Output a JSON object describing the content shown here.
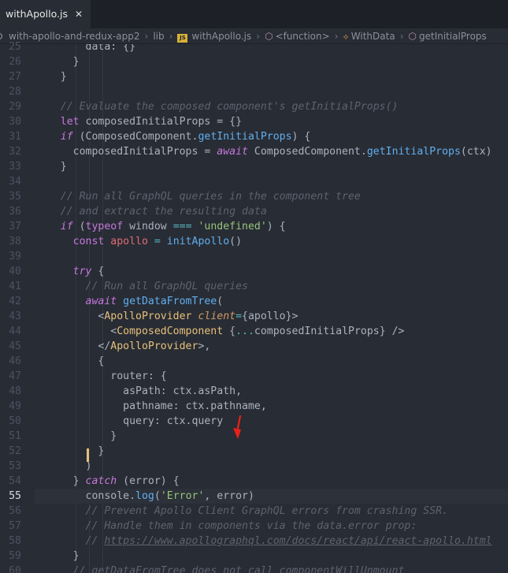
{
  "tab": {
    "title": "withApollo.js",
    "close": "✕"
  },
  "breadcrumb": [
    {
      "label": "with-apollo-and-redux-app2",
      "icon": "disk-icon"
    },
    {
      "label": "lib",
      "icon": ""
    },
    {
      "label": "withApollo.js",
      "icon": "js-file-icon"
    },
    {
      "label": "<function>",
      "icon": "cube-icon"
    },
    {
      "label": "WithData",
      "icon": "component-icon"
    },
    {
      "label": "getInitialProps",
      "icon": "cube-icon"
    }
  ],
  "editor": {
    "current_line": 55,
    "line_numbers": [
      25,
      26,
      27,
      28,
      29,
      30,
      31,
      32,
      33,
      34,
      35,
      36,
      37,
      38,
      39,
      40,
      41,
      42,
      43,
      44,
      45,
      46,
      47,
      48,
      49,
      50,
      51,
      52,
      53,
      54,
      55,
      56,
      57,
      58,
      59,
      60
    ],
    "lines": [
      [
        [
          "p",
          "        data: {}"
        ]
      ],
      [
        [
          "p",
          "      }"
        ]
      ],
      [
        [
          "p",
          "    }"
        ]
      ],
      [
        [
          "p",
          ""
        ]
      ],
      [
        [
          "c",
          "    // Evaluate the composed component's getInitialProps()"
        ]
      ],
      [
        [
          "k",
          "    let "
        ],
        [
          "p",
          "composedInitialProps = {}"
        ]
      ],
      [
        [
          "ki",
          "    if "
        ],
        [
          "p",
          "(ComposedComponent."
        ],
        [
          "f",
          "getInitialProps"
        ],
        [
          "p",
          ") {"
        ]
      ],
      [
        [
          "p",
          "      composedInitialProps = "
        ],
        [
          "ki",
          "await "
        ],
        [
          "p",
          "ComposedComponent."
        ],
        [
          "f",
          "getInitialProps"
        ],
        [
          "p",
          "(ctx)"
        ]
      ],
      [
        [
          "p",
          "    }"
        ]
      ],
      [
        [
          "p",
          ""
        ]
      ],
      [
        [
          "c",
          "    // Run all GraphQL queries in the component tree"
        ]
      ],
      [
        [
          "c",
          "    // and extract the resulting data"
        ]
      ],
      [
        [
          "ki",
          "    if "
        ],
        [
          "p",
          "("
        ],
        [
          "k",
          "typeof "
        ],
        [
          "p",
          "window "
        ],
        [
          "o",
          "=== "
        ],
        [
          "s",
          "'undefined'"
        ],
        [
          "p",
          ") {"
        ]
      ],
      [
        [
          "k",
          "      const "
        ],
        [
          "v",
          "apollo "
        ],
        [
          "o",
          "= "
        ],
        [
          "f",
          "initApollo"
        ],
        [
          "p",
          "()"
        ]
      ],
      [
        [
          "p",
          ""
        ]
      ],
      [
        [
          "ki",
          "      try "
        ],
        [
          "p",
          "{"
        ]
      ],
      [
        [
          "c",
          "        // Run all GraphQL queries"
        ]
      ],
      [
        [
          "ki",
          "        await "
        ],
        [
          "f",
          "getDataFromTree"
        ],
        [
          "p",
          "("
        ]
      ],
      [
        [
          "p",
          "          <"
        ],
        [
          "tag",
          "ApolloProvider "
        ],
        [
          "attr",
          "client"
        ],
        [
          "o",
          "="
        ],
        [
          "p",
          "{apollo}>"
        ]
      ],
      [
        [
          "p",
          "            <"
        ],
        [
          "tag",
          "ComposedComponent "
        ],
        [
          "p",
          "{"
        ],
        [
          "o",
          "..."
        ],
        [
          "p",
          "composedInitialProps} />"
        ]
      ],
      [
        [
          "p",
          "          </"
        ],
        [
          "tag",
          "ApolloProvider"
        ],
        [
          "p",
          ">,"
        ]
      ],
      [
        [
          "p",
          "          {"
        ]
      ],
      [
        [
          "p",
          "            router: {"
        ]
      ],
      [
        [
          "p",
          "              asPath: ctx.asPath,"
        ]
      ],
      [
        [
          "p",
          "              pathname: ctx.pathname,"
        ]
      ],
      [
        [
          "p",
          "              query: ctx.query"
        ]
      ],
      [
        [
          "p",
          "            }"
        ]
      ],
      [
        [
          "p",
          "          }"
        ]
      ],
      [
        [
          "p",
          "        )"
        ]
      ],
      [
        [
          "p",
          "      } "
        ],
        [
          "ki",
          "catch "
        ],
        [
          "p",
          "(error) {"
        ]
      ],
      [
        [
          "p",
          "        console."
        ],
        [
          "f",
          "log"
        ],
        [
          "p",
          "("
        ],
        [
          "s",
          "'Error'"
        ],
        [
          "p",
          ", error)"
        ]
      ],
      [
        [
          "c",
          "        // Prevent Apollo Client GraphQL errors from crashing SSR."
        ]
      ],
      [
        [
          "c",
          "        // Handle them in components via the data.error prop:"
        ]
      ],
      [
        [
          "c",
          "        // "
        ],
        [
          "u",
          "https://www.apollographql.com/docs/react/api/react-apollo.html"
        ]
      ],
      [
        [
          "p",
          "      }"
        ]
      ],
      [
        [
          "c",
          "      // getDataFromTree does not call componentWillUnmount"
        ]
      ]
    ]
  }
}
